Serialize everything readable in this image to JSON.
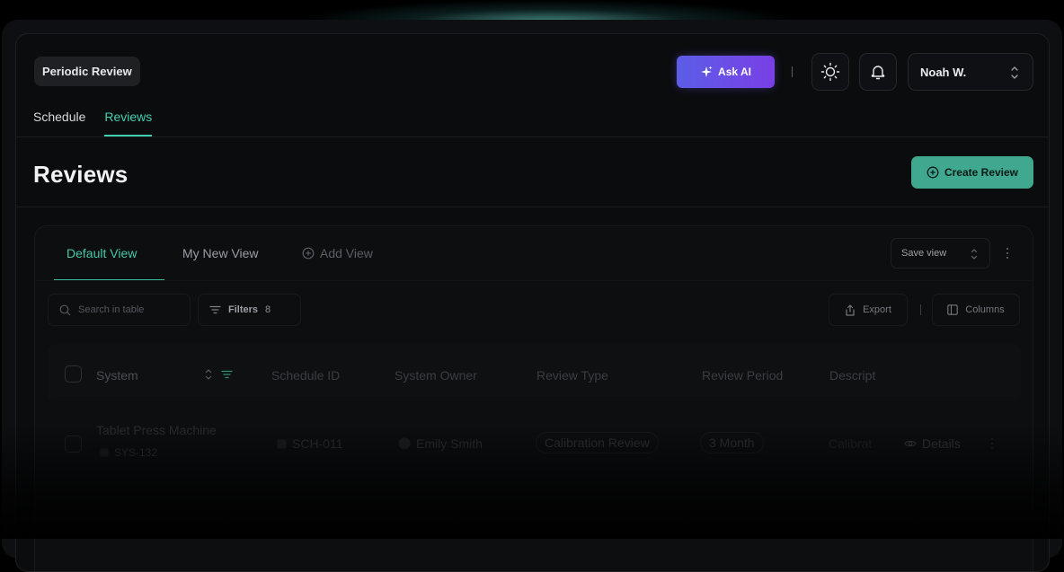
{
  "header": {
    "breadcrumb": "Periodic Review",
    "subtabs": [
      "Schedule",
      "Reviews"
    ],
    "ask_ai_label": "Ask AI",
    "user_name": "Noah W."
  },
  "page": {
    "title": "Reviews",
    "create_button": "Create Review"
  },
  "views": {
    "tabs": [
      "Default View",
      "My New View"
    ],
    "add_view": "Add View",
    "save_view": "Save view"
  },
  "toolbar": {
    "search_placeholder": "Search in table",
    "filters_label": "Filters",
    "filters_count": "8",
    "export_label": "Export",
    "columns_label": "Columns"
  },
  "table": {
    "columns": [
      "System",
      "Schedule ID",
      "System Owner",
      "Review Type",
      "Review Period",
      "Descript"
    ],
    "rows": [
      {
        "system": "Tablet Press Machine",
        "system_id": "SYS-132",
        "schedule_id": "SCH-011",
        "owner": "Emily Smith",
        "review_type": "Calibration Review",
        "review_period": "3 Month",
        "description": "Calibrat",
        "details": "Details"
      }
    ]
  },
  "colors": {
    "accent": "#45d1b2",
    "ask_ai_gradient_start": "#5b5de6",
    "ask_ai_gradient_end": "#7a3fe6",
    "background": "#0b0c0e"
  }
}
